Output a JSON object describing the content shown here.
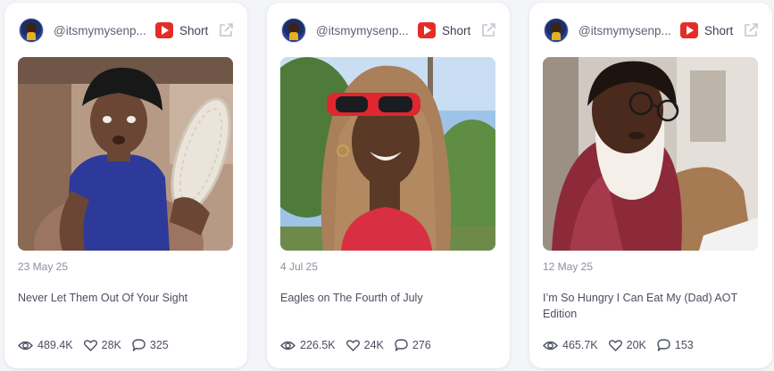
{
  "cards": [
    {
      "handle": "@itsmymysenp...",
      "platform_label": "Short",
      "date": "23 May 25",
      "title": "Never Let Them Out Of Your Sight",
      "views": "489.4K",
      "likes": "28K",
      "comments": "325"
    },
    {
      "handle": "@itsmymysenp...",
      "platform_label": "Short",
      "date": "4 Jul 25",
      "title": "Eagles on The Fourth of July",
      "views": "226.5K",
      "likes": "24K",
      "comments": "276"
    },
    {
      "handle": "@itsmymysenp...",
      "platform_label": "Short",
      "date": "12 May 25",
      "title": "I’m So Hungry I Can Eat My (Dad) AOT Edition",
      "views": "465.7K",
      "likes": "20K",
      "comments": "153"
    }
  ],
  "icons": {
    "platform": "youtube-icon",
    "external": "external-link-icon",
    "views": "eye-icon",
    "likes": "heart-icon",
    "comments": "comment-icon"
  },
  "colors": {
    "youtube_red": "#e52d27",
    "card_bg": "#ffffff",
    "page_bg": "#f4f5f9"
  }
}
